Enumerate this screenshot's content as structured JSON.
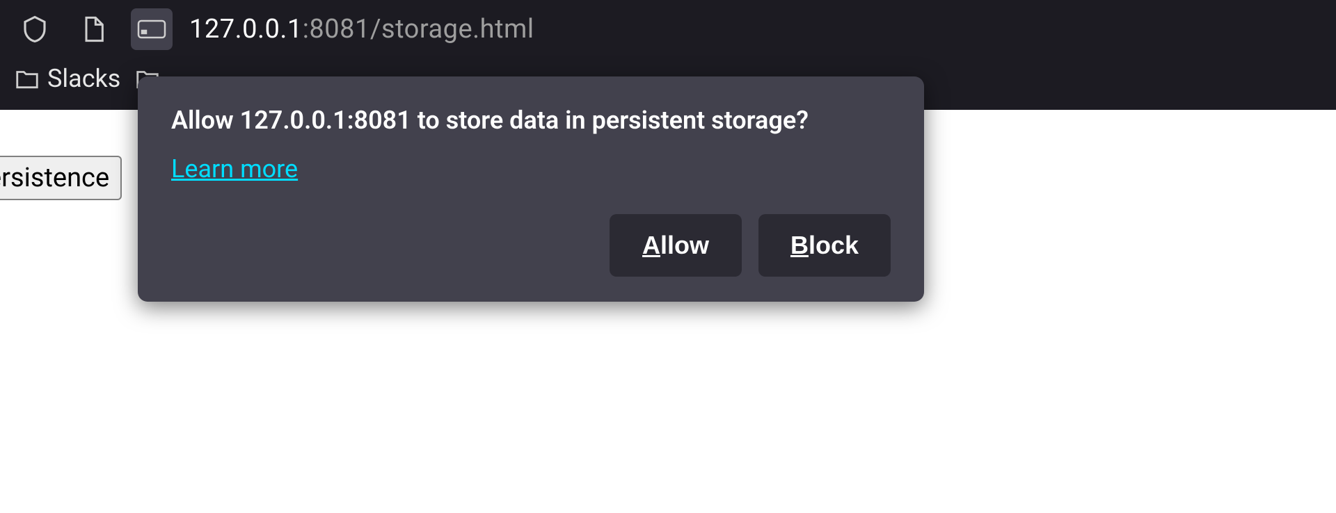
{
  "url": {
    "host": "127.0.0.1",
    "port_path": ":8081/storage.html"
  },
  "bookmarks": {
    "item0": "Slacks"
  },
  "page": {
    "button_label": "ersistence"
  },
  "popup": {
    "title": "Allow 127.0.0.1:8081 to store data in persistent storage?",
    "learn_more": "Learn more",
    "allow_first": "A",
    "allow_rest": "llow",
    "block_first": "B",
    "block_rest": "lock"
  }
}
